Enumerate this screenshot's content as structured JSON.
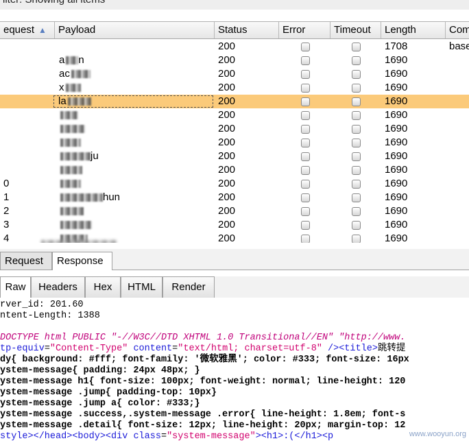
{
  "filter_text": "ilter: Showing all items",
  "table": {
    "columns": [
      {
        "id": "request",
        "label": "equest"
      },
      {
        "id": "payload",
        "label": "Payload"
      },
      {
        "id": "status",
        "label": "Status"
      },
      {
        "id": "error",
        "label": "Error"
      },
      {
        "id": "timeout",
        "label": "Timeout"
      },
      {
        "id": "length",
        "label": "Length"
      },
      {
        "id": "comment",
        "label": "Com"
      }
    ],
    "sort_icon": "sort-ascending-icon",
    "rows": [
      {
        "request": "",
        "payload": "",
        "status": "200",
        "length": "1708",
        "comment": "base"
      },
      {
        "request": "",
        "payload": "a",
        "payload_tail": "n",
        "status": "200",
        "length": "1690",
        "comment": ""
      },
      {
        "request": "",
        "payload": "ac",
        "payload_tail": "",
        "status": "200",
        "length": "1690",
        "comment": ""
      },
      {
        "request": "",
        "payload": "x",
        "payload_tail": "",
        "status": "200",
        "length": "1690",
        "comment": ""
      },
      {
        "request": "",
        "payload": "la",
        "payload_tail": "",
        "status": "200",
        "length": "1690",
        "comment": "",
        "selected": true
      },
      {
        "request": "",
        "payload": "",
        "payload_tail": "",
        "status": "200",
        "length": "1690",
        "comment": ""
      },
      {
        "request": "",
        "payload": "",
        "payload_tail": "",
        "status": "200",
        "length": "1690",
        "comment": ""
      },
      {
        "request": "",
        "payload": "",
        "payload_tail": "",
        "status": "200",
        "length": "1690",
        "comment": ""
      },
      {
        "request": "",
        "payload": "",
        "payload_tail": "ju",
        "status": "200",
        "length": "1690",
        "comment": ""
      },
      {
        "request": "",
        "payload": "",
        "payload_tail": "",
        "status": "200",
        "length": "1690",
        "comment": ""
      },
      {
        "request": "0",
        "payload": "",
        "payload_tail": "",
        "status": "200",
        "length": "1690",
        "comment": ""
      },
      {
        "request": "1",
        "payload": "",
        "payload_tail": "hun",
        "status": "200",
        "length": "1690",
        "comment": ""
      },
      {
        "request": "2",
        "payload": "",
        "payload_tail": "",
        "status": "200",
        "length": "1690",
        "comment": ""
      },
      {
        "request": "3",
        "payload": "",
        "payload_tail": "",
        "status": "200",
        "length": "1690",
        "comment": ""
      },
      {
        "request": "4",
        "payload": "",
        "payload_tail": "",
        "status": "200",
        "length": "1690",
        "comment": ""
      }
    ]
  },
  "tabs_top": [
    {
      "label": "Request",
      "active": false
    },
    {
      "label": "Response",
      "active": true
    }
  ],
  "tabs_view": [
    {
      "label": "Raw",
      "active": true
    },
    {
      "label": "Headers",
      "active": false
    },
    {
      "label": "Hex",
      "active": false
    },
    {
      "label": "HTML",
      "active": false
    },
    {
      "label": "Render",
      "active": false
    }
  ],
  "response": {
    "line1": "rver_id: 201.60",
    "line2": "ntent-Length: 1388",
    "doctype_a": "DOCTYPE html PUBLIC ",
    "doctype_b": "\"-//W3C//DTD XHTML 1.0 Transitional//EN\" \"http://www.",
    "meta_a": "tp-equiv",
    "meta_b": "=",
    "meta_c": "\"Content-Type\"",
    "meta_d": " content",
    "meta_e": "=",
    "meta_f": "\"text/html; charset=utf-8\"",
    "meta_g": " /><title>",
    "meta_h": "跳转提",
    "css1": "dy{ background: #fff; font-family: '微软雅黑'; color: #333; font-size: 16px",
    "css2": "ystem-message{ padding: 24px 48px; }",
    "css3": "ystem-message h1{ font-size: 100px; font-weight: normal; line-height: 120",
    "css4": "ystem-message .jump{ padding-top: 10px}",
    "css5": "ystem-message .jump a{ color: #333;}",
    "css6": "ystem-message .success,.system-message .error{ line-height: 1.8em; font-s",
    "css7": "ystem-message .detail{ font-size: 12px; line-height: 20px; margin-top: 12",
    "last_a": "style></head><body><div ",
    "last_b": "class",
    "last_c": "=",
    "last_d": "\"system-message\"",
    "last_e": "><h1>:(</h1><p"
  },
  "watermark": "www.wooyun.org",
  "colors": {
    "selected_row": "#fbca7a",
    "keyword_blue": "#1a1ad8",
    "string_pink": "#d1006d"
  }
}
